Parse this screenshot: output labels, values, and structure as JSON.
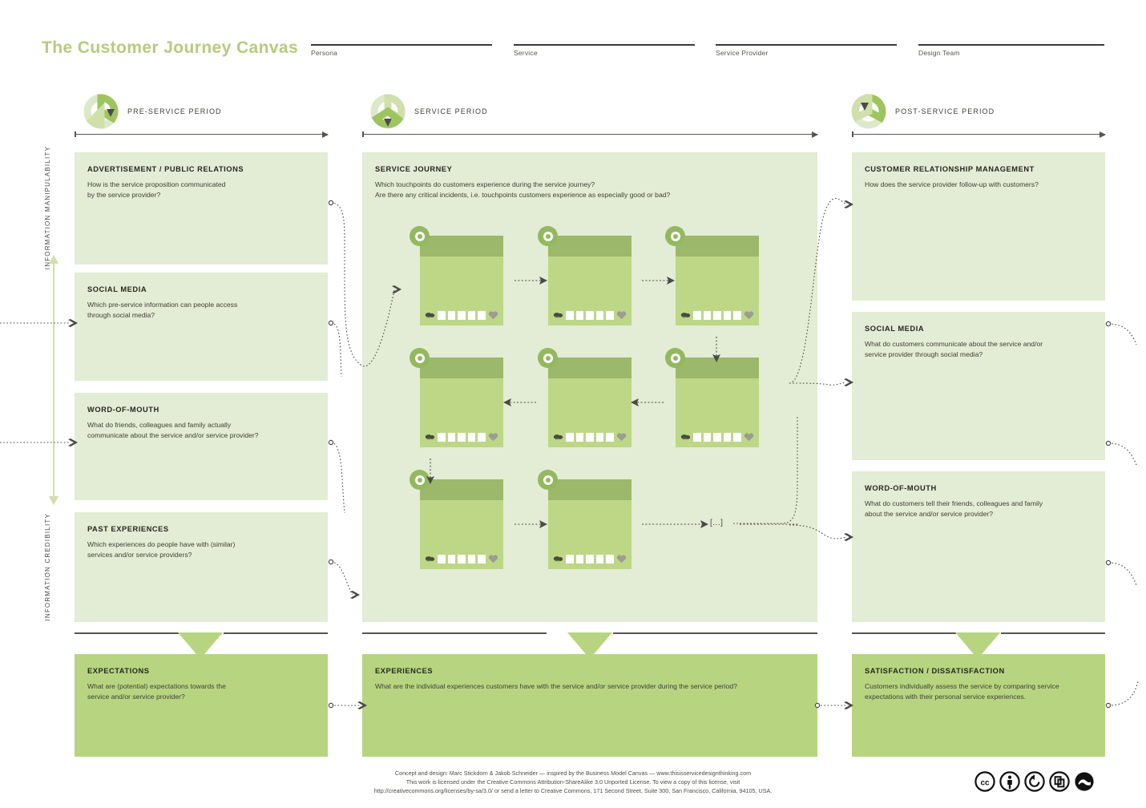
{
  "header": {
    "title": "The Customer Journey Canvas",
    "title_color": "#b4cc7f",
    "fields": [
      {
        "label": "Persona"
      },
      {
        "label": "Service"
      },
      {
        "label": "Service Provider"
      },
      {
        "label": "Design Team"
      }
    ]
  },
  "periods": [
    {
      "label": "PRE-SERVICE PERIOD",
      "icon": "pie-chart-icon"
    },
    {
      "label": "SERVICE PERIOD",
      "icon": "pie-chart-icon"
    },
    {
      "label": "POST-SERVICE PERIOD",
      "icon": "pie-chart-icon"
    }
  ],
  "side_axis": {
    "top_label": "INFORMATION MANIPULABILITY",
    "bottom_label": "INFORMATION CREDIBILITY",
    "arrow": "double-headed-vertical-arrow-icon"
  },
  "pre_service": [
    {
      "title": "ADVERTISEMENT / PUBLIC RELATIONS",
      "body": "How is the service proposition communicated\nby the service provider?"
    },
    {
      "title": "SOCIAL MEDIA",
      "body": "Which pre-service information can people access\nthrough social media?"
    },
    {
      "title": "WORD-OF-MOUTH",
      "body": "What do friends, colleagues and family actually\ncommunicate about the service and/or service provider?"
    },
    {
      "title": "PAST EXPERIENCES",
      "body": "Which experiences do people have with (similar)\nservices and/or service providers?"
    }
  ],
  "service_journey": {
    "title": "SERVICE JOURNEY",
    "body": "Which touchpoints do customers experience during the service journey?\nAre there any critical incidents, i.e. touchpoints customers experience as especially good or bad?",
    "continuation_marker": "[...]",
    "touchpoint_count": 8,
    "touchpoint_rating_boxes": 5,
    "touchpoint_icons": [
      "cloud-icon",
      "heart-icon",
      "circle-badge-icon"
    ]
  },
  "post_service": [
    {
      "title": "CUSTOMER RELATIONSHIP MANAGEMENT",
      "body": "How does the service provider follow-up with customers?"
    },
    {
      "title": "SOCIAL MEDIA",
      "body": "What do customers communicate about the service and/or\nservice provider through social media?"
    },
    {
      "title": "WORD-OF-MOUTH",
      "body": "What do customers tell their friends, colleagues and family\nabout the service and/or service provider?"
    }
  ],
  "bottom_row": [
    {
      "title": "EXPECTATIONS",
      "body": "What are (potential) expectations towards the\nservice and/or service provider?"
    },
    {
      "title": "EXPERIENCES",
      "body": "What are the individual experiences customers have with the service and/or service provider during the service period?"
    },
    {
      "title": "SATISFACTION / DISSATISFACTION",
      "body": "Customers individually assess the service by comparing service\nexpectations with their personal service experiences."
    }
  ],
  "footer": {
    "line1": "Concept and design: Marc Stickdorn & Jakob Schneider — inspired by the Business Model Canvas — www.thisisservicedesignthinking.com",
    "line2": "This work is licensed under the Creative Commons Attribution-ShareAlike 3.0 Unported License. To view a copy of this license, visit",
    "line3": "http://creativecommons.org/licenses/by-sa/3.0/ or send a letter to Creative Commons, 171 Second Street, Suite 300, San Francisco, California, 94105, USA.",
    "license_icons": [
      "cc-icon",
      "cc-by-icon",
      "cc-share-alike-icon",
      "cc-remix-icon",
      "cc-sampling-icon"
    ]
  },
  "colors": {
    "panel_bg": "#e3ecd4",
    "strong_bg": "#b7d580",
    "card_body": "#bdd787",
    "card_header": "#9cb86b",
    "badge": "#93b85f",
    "title": "#b4cc7f",
    "ink": "#3f3f39"
  }
}
